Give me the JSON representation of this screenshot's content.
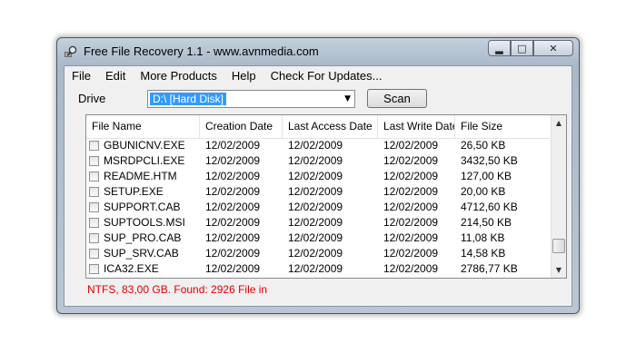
{
  "window": {
    "title": "Free File Recovery 1.1  - www.avnmedia.com"
  },
  "menu": [
    "File",
    "Edit",
    "More Products",
    "Help",
    "Check For Updates..."
  ],
  "drive": {
    "label": "Drive",
    "selected": "D:\\ [Hard Disk]",
    "scan_label": "Scan"
  },
  "table": {
    "columns": [
      "File Name",
      "Creation Date",
      "Last Access Date",
      "Last Write Date",
      "File Size"
    ],
    "rows": [
      [
        "GBUNICNV.EXE",
        "12/02/2009",
        "12/02/2009",
        "12/02/2009",
        "26,50 KB"
      ],
      [
        "MSRDPCLI.EXE",
        "12/02/2009",
        "12/02/2009",
        "12/02/2009",
        "3432,50 KB"
      ],
      [
        "README.HTM",
        "12/02/2009",
        "12/02/2009",
        "12/02/2009",
        "127,00 KB"
      ],
      [
        "SETUP.EXE",
        "12/02/2009",
        "12/02/2009",
        "12/02/2009",
        "20,00 KB"
      ],
      [
        "SUPPORT.CAB",
        "12/02/2009",
        "12/02/2009",
        "12/02/2009",
        "4712,60 KB"
      ],
      [
        "SUPTOOLS.MSI",
        "12/02/2009",
        "12/02/2009",
        "12/02/2009",
        "214,50 KB"
      ],
      [
        "SUP_PRO.CAB",
        "12/02/2009",
        "12/02/2009",
        "12/02/2009",
        "11,08 KB"
      ],
      [
        "SUP_SRV.CAB",
        "12/02/2009",
        "12/02/2009",
        "12/02/2009",
        "14,58 KB"
      ],
      [
        "ICA32.EXE",
        "12/02/2009",
        "12/02/2009",
        "12/02/2009",
        "2786,77 KB"
      ]
    ]
  },
  "status": {
    "text": "NTFS, 83,00 GB. Found: 2926 File in"
  },
  "colors": {
    "status_text": "#e00000",
    "selection": "#3399ff"
  },
  "icons": {
    "app": "magnifier-icon",
    "minimize": "minimize-icon",
    "maximize": "maximize-icon",
    "close": "close-icon",
    "dropdown": "chevron-down-icon"
  }
}
